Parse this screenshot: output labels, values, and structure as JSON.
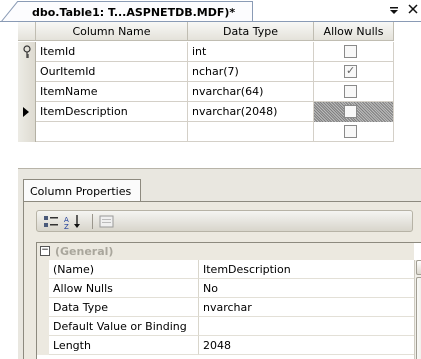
{
  "document_tab": {
    "title": "dbo.Table1: T...ASPNETDB.MDF)*"
  },
  "grid": {
    "headers": [
      "Column Name",
      "Data Type",
      "Allow Nulls"
    ],
    "rows": [
      {
        "name": "ItemId",
        "type": "int",
        "allow_nulls": false,
        "primary_key": true,
        "current": false
      },
      {
        "name": "OurItemId",
        "type": "nchar(7)",
        "allow_nulls": true,
        "primary_key": false,
        "current": false
      },
      {
        "name": "ItemName",
        "type": "nvarchar(64)",
        "allow_nulls": false,
        "primary_key": false,
        "current": false
      },
      {
        "name": "ItemDescription",
        "type": "nvarchar(2048)",
        "allow_nulls": false,
        "primary_key": false,
        "current": true
      },
      {
        "name": "",
        "type": "",
        "allow_nulls": false,
        "primary_key": false,
        "current": false
      }
    ]
  },
  "column_properties": {
    "tab_label": "Column Properties",
    "category": "(General)",
    "properties": [
      {
        "name": "(Name)",
        "value": "ItemDescription"
      },
      {
        "name": "Allow Nulls",
        "value": "No"
      },
      {
        "name": "Data Type",
        "value": "nvarchar"
      },
      {
        "name": "Default Value or Binding",
        "value": ""
      },
      {
        "name": "Length",
        "value": "2048"
      }
    ]
  },
  "icons": {
    "tab_menu": "dropdown-menu-icon",
    "tab_close": "close-icon",
    "categorized": "categorized-icon",
    "alphabetical": "alphabetical-sort-icon",
    "property_pages": "property-pages-icon",
    "primary_key": "key-icon",
    "current_row": "row-indicator-icon"
  }
}
